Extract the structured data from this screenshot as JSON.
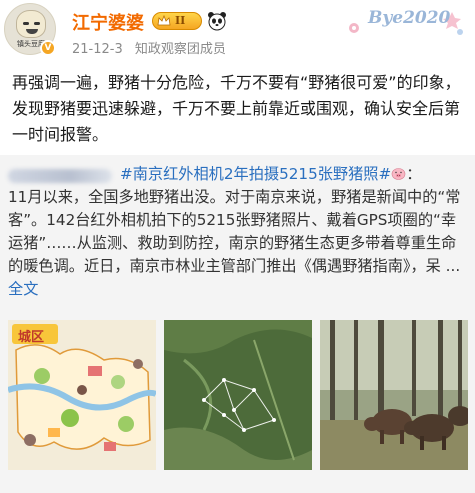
{
  "post": {
    "author": "江宁婆婆",
    "level": "II",
    "avatar_caption": "镇头豆腐",
    "date": "21-12-3",
    "source": "知政观察团成员",
    "decor_text": "Bye2020",
    "body": "再强调一遍，野猪十分危险，千万不要有“野猪很可爱”的印象，发现野猪要迅速躲避，千万不要上前靠近或围观，确认安全后第一时间报警。"
  },
  "repost": {
    "topic": "#南京红外相机2年拍摄5215张野猪照#",
    "colon": "：",
    "line1_rest": "11月以来，全国多地野猪出没。对于南京来说，野猪是新闻中的“常客”。142台红外相机拍下的5215张野猪照片、戴着GPS项圈的“幸运猪”……从监测、救助到防控，南京的野猪生态更多带着尊重生命的暖色调。近日，南京市林业主管部门推出《偶遇野猪指南》，呆 ...",
    "full_text_link": "全文",
    "map_title": "城区"
  },
  "colors": {
    "username": "#f26a00",
    "link": "#2a6fbf",
    "meta": "#8a8a8a",
    "card_bg": "#f4f4f4"
  }
}
